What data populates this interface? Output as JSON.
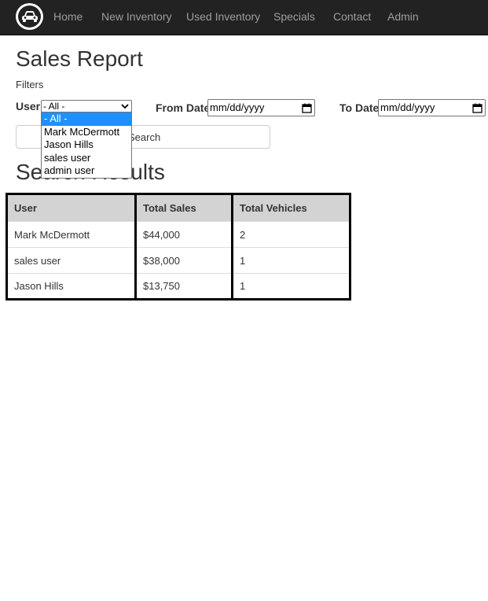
{
  "nav": {
    "links": [
      "Home",
      "New Inventory",
      "Used Inventory",
      "Specials",
      "Contact",
      "Admin"
    ],
    "brand_icon": "car-icon"
  },
  "page": {
    "title": "Sales Report",
    "filters_label": "Filters"
  },
  "filters": {
    "user_label": "User",
    "user_selected": "- All -",
    "user_options": [
      "- All -",
      "Mark McDermott",
      "Jason Hills",
      "sales user",
      "admin user"
    ],
    "from_date_label": "From Date",
    "from_date_placeholder": "mm/dd/yyyy",
    "to_date_label": "To Date",
    "to_date_placeholder": "mm/dd/yyyy",
    "search_label": "Search"
  },
  "results": {
    "title": "Search Results",
    "columns": [
      "User",
      "Total Sales",
      "Total Vehicles"
    ],
    "rows": [
      [
        "Mark McDermott",
        "$44,000",
        "2"
      ],
      [
        "sales user",
        "$38,000",
        "1"
      ],
      [
        "Jason Hills",
        "$13,750",
        "1"
      ]
    ]
  },
  "colors": {
    "navbar_bg": "#222222",
    "nav_link": "#9d9d9d",
    "header_row_bg": "#d3d3d3",
    "selected_option_bg": "#1e90ff"
  }
}
